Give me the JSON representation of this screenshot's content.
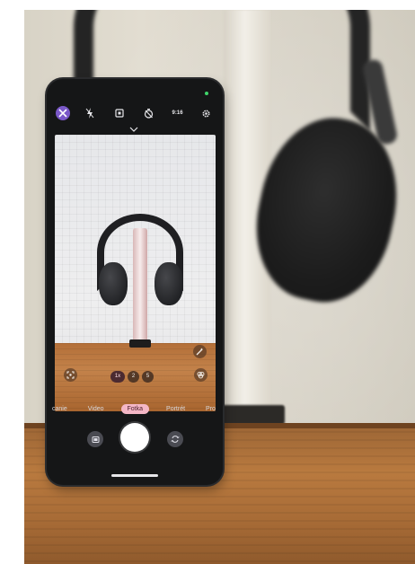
{
  "camera": {
    "top_icons": [
      {
        "name": "shutter-mode-icon",
        "glyph": "⌗",
        "active": true
      },
      {
        "name": "flash-off-icon",
        "glyph": "ϟ",
        "active": false
      },
      {
        "name": "motion-photo-icon",
        "glyph": "▣",
        "active": false
      },
      {
        "name": "timer-off-icon",
        "glyph": "⊘",
        "active": false
      },
      {
        "name": "aspect-ratio-icon",
        "glyph": "",
        "active": false
      },
      {
        "name": "settings-gear-icon",
        "glyph": "⚙",
        "active": false
      }
    ],
    "aspect_ratio_label": "9:16",
    "zoom_levels": [
      "1x",
      "2",
      "5"
    ],
    "zoom_selected": "1x",
    "modes": [
      {
        "label": "canie",
        "selected": false
      },
      {
        "label": "Video",
        "selected": false
      },
      {
        "label": "Fotka",
        "selected": true
      },
      {
        "label": "Portrét",
        "selected": false
      },
      {
        "label": "Pro",
        "selected": false
      }
    ],
    "accent_color": "#f4b7c6",
    "active_icon_color": "#7a58c8"
  }
}
